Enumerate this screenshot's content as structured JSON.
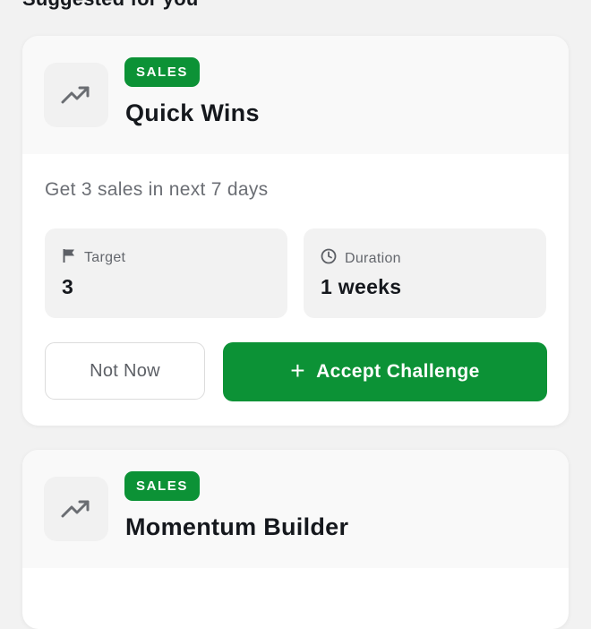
{
  "section": {
    "title": "Suggested for you"
  },
  "challenges": [
    {
      "category": "SALES",
      "title": "Quick Wins",
      "icon": "trending-up-icon",
      "description": "Get 3 sales in next 7 days",
      "target_label": "Target",
      "target_value": "3",
      "duration_label": "Duration",
      "duration_value": "1 weeks",
      "dismiss_label": "Not Now",
      "accept_label": "Accept Challenge",
      "accept_icon": "+"
    },
    {
      "category": "SALES",
      "title": "Momentum Builder",
      "icon": "trending-up-icon"
    }
  ],
  "colors": {
    "accent": "#0c9236",
    "page_background": "#f2f2f2",
    "card_background": "#ffffff",
    "text_primary": "#15181d",
    "text_secondary": "#6b6e74"
  }
}
